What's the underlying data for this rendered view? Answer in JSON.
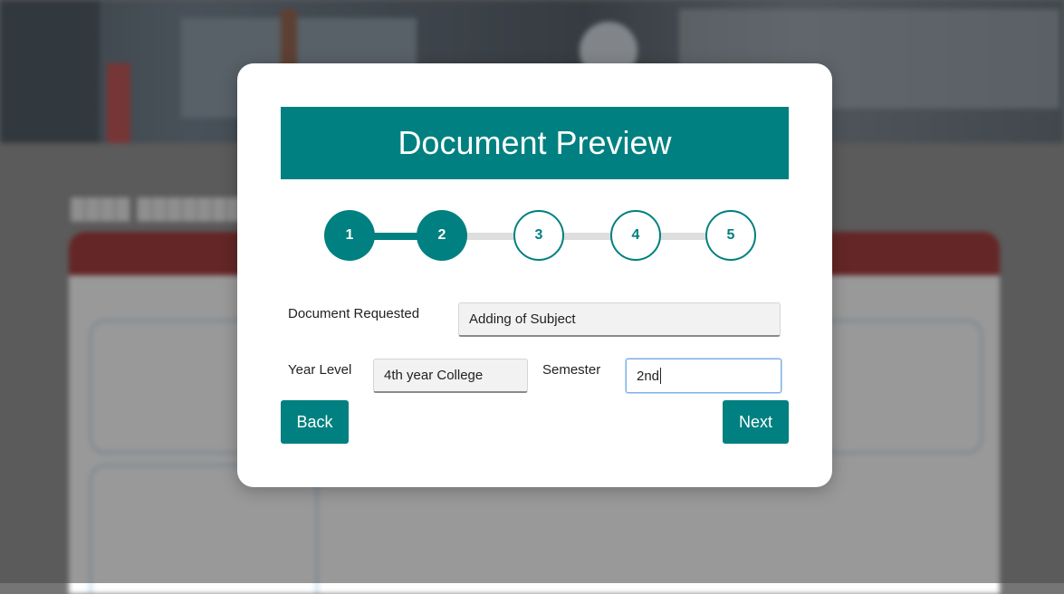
{
  "modal": {
    "title": "Document Preview",
    "steps": [
      "1",
      "2",
      "3",
      "4",
      "5"
    ],
    "current_step": 2,
    "form": {
      "document_label": "Document Requested",
      "document_value": "Adding of Subject",
      "year_label": "Year Level",
      "year_value": "4th year College",
      "semester_label": "Semester",
      "semester_value": "2nd"
    },
    "back_label": "Back",
    "next_label": "Next"
  },
  "colors": {
    "accent": "#008080",
    "background_card_header": "#8b0000"
  }
}
